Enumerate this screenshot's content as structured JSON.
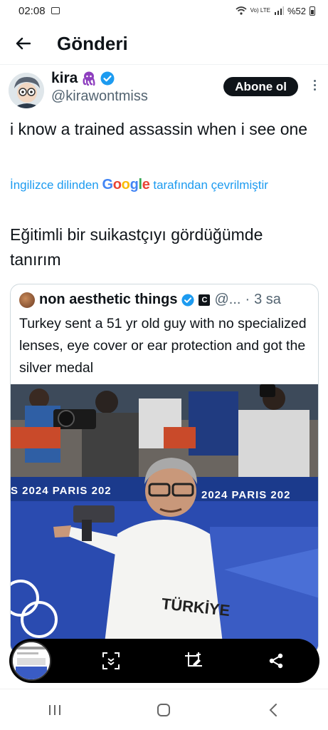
{
  "status_bar": {
    "time": "02:08",
    "network": "Vo) LTE",
    "battery": "%52"
  },
  "header": {
    "title": "Gönderi"
  },
  "tweet": {
    "display_name": "kira",
    "handle": "@kirawontmiss",
    "follow_label": "Abone ol",
    "text": "i know a trained assassin when i see one",
    "translate_prefix": "İngilizce dilinden",
    "translate_provider": "Google",
    "translate_suffix": "tarafından çevrilmiştir",
    "translated_text": "Eğitimli bir suikastçıyı gördüğümde tanırım"
  },
  "quote": {
    "display_name": "non aesthetic things",
    "badge": "C",
    "handle": "@...",
    "separator": "·",
    "time": "3 sa",
    "text": "Turkey sent a 51 yr old guy with no specialized lenses, eye cover or ear protection and got the silver medal",
    "image_banner_left": "S 2024  PARIS 202",
    "image_banner_right": "2024  PARIS 202",
    "image_shirt_text": "TÜRKİYE"
  },
  "colors": {
    "accent": "#1d9bf0",
    "text": "#0f1419",
    "muted": "#536471",
    "banner": "#1b3a8c"
  }
}
